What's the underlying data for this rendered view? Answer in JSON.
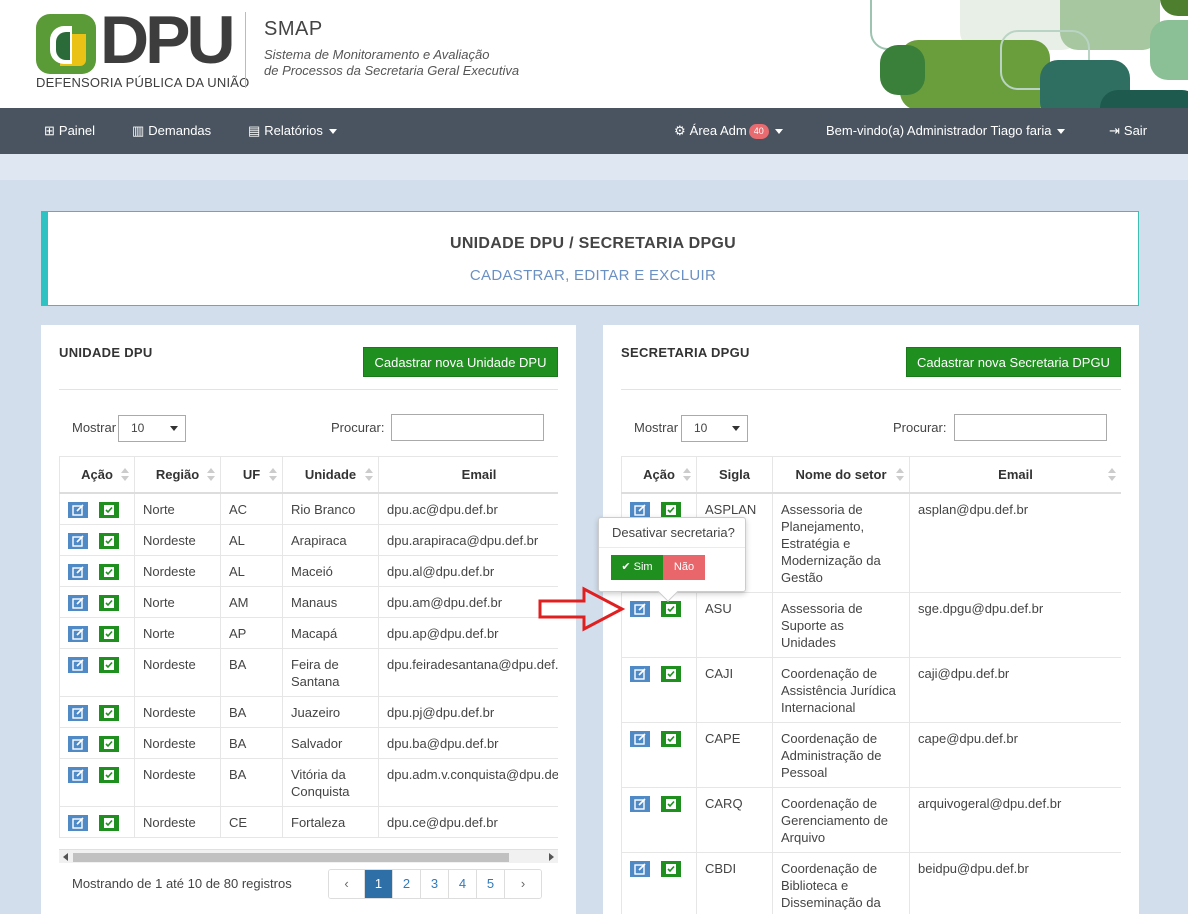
{
  "header": {
    "logo_text": "DPU",
    "logo_subtitle": "DEFENSORIA PÚBLICA DA UNIÃO",
    "app_name": "SMAP",
    "app_description_line1": "Sistema de Monitoramento e Avaliação",
    "app_description_line2": "de Processos da Secretaria Geral Executiva"
  },
  "navbar": {
    "painel": "Painel",
    "demandas": "Demandas",
    "relatorios": "Relatórios",
    "area_adm": "Área Adm",
    "area_adm_count": "40",
    "welcome": "Bem-vindo(a) Administrador Tiago faria",
    "sair": "Sair"
  },
  "page": {
    "title": "UNIDADE DPU / SECRETARIA DPGU",
    "subtitle": "CADASTRAR, EDITAR E EXCLUIR"
  },
  "unidade_panel": {
    "title": "UNIDADE DPU",
    "new_button": "Cadastrar nova Unidade DPU",
    "show_label": "Mostrar",
    "show_value": "10",
    "search_label": "Procurar:",
    "columns": [
      "Ação",
      "Região",
      "UF",
      "Unidade",
      "Email"
    ],
    "rows": [
      {
        "regiao": "Norte",
        "uf": "AC",
        "unidade": "Rio Branco",
        "email": "dpu.ac@dpu.def.br"
      },
      {
        "regiao": "Nordeste",
        "uf": "AL",
        "unidade": "Arapiraca",
        "email": "dpu.arapiraca@dpu.def.br"
      },
      {
        "regiao": "Nordeste",
        "uf": "AL",
        "unidade": "Maceió",
        "email": "dpu.al@dpu.def.br"
      },
      {
        "regiao": "Norte",
        "uf": "AM",
        "unidade": "Manaus",
        "email": "dpu.am@dpu.def.br"
      },
      {
        "regiao": "Norte",
        "uf": "AP",
        "unidade": "Macapá",
        "email": "dpu.ap@dpu.def.br"
      },
      {
        "regiao": "Nordeste",
        "uf": "BA",
        "unidade": "Feira de Santana",
        "email": "dpu.feiradesantana@dpu.def.br"
      },
      {
        "regiao": "Nordeste",
        "uf": "BA",
        "unidade": "Juazeiro",
        "email": "dpu.pj@dpu.def.br"
      },
      {
        "regiao": "Nordeste",
        "uf": "BA",
        "unidade": "Salvador",
        "email": "dpu.ba@dpu.def.br"
      },
      {
        "regiao": "Nordeste",
        "uf": "BA",
        "unidade": "Vitória da Conquista",
        "email": "dpu.adm.v.conquista@dpu.def.br"
      },
      {
        "regiao": "Nordeste",
        "uf": "CE",
        "unidade": "Fortaleza",
        "email": "dpu.ce@dpu.def.br"
      }
    ],
    "info": "Mostrando de 1 até 10 de 80 registros",
    "pagination": {
      "prev": "‹",
      "pages": [
        "1",
        "2",
        "3",
        "4",
        "5"
      ],
      "active": "1",
      "next": "›"
    }
  },
  "secretaria_panel": {
    "title": "SECRETARIA DPGU",
    "new_button": "Cadastrar nova Secretaria DPGU",
    "show_label": "Mostrar",
    "show_value": "10",
    "search_label": "Procurar:",
    "columns": [
      "Ação",
      "Sigla",
      "Nome do setor",
      "Email"
    ],
    "rows": [
      {
        "sigla": "ASPLAN",
        "nome": "Assessoria de Planejamento, Estratégia e Modernização da Gestão",
        "email": "asplan@dpu.def.br"
      },
      {
        "sigla": "ASU",
        "nome": "Assessoria de Suporte as Unidades",
        "email": "sge.dpgu@dpu.def.br"
      },
      {
        "sigla": "CAJI",
        "nome": "Coordenação de Assistência Jurídica Internacional",
        "email": "caji@dpu.def.br"
      },
      {
        "sigla": "CAPE",
        "nome": "Coordenação de Administração de Pessoal",
        "email": "cape@dpu.def.br"
      },
      {
        "sigla": "CARQ",
        "nome": "Coordenação de Gerenciamento de Arquivo",
        "email": "arquivogeral@dpu.def.br"
      },
      {
        "sigla": "CBDI",
        "nome": "Coordenação de Biblioteca e Disseminação da",
        "email": "beidpu@dpu.def.br"
      }
    ]
  },
  "popover": {
    "question": "Desativar secretaria?",
    "yes": "Sim",
    "no": "Não"
  },
  "colors": {
    "navbar": "#4a5460",
    "green_button": "#1f8f1f",
    "edit_button": "#4f89c6",
    "no_button": "#e9666b",
    "annotation_arrow": "#e02020"
  }
}
